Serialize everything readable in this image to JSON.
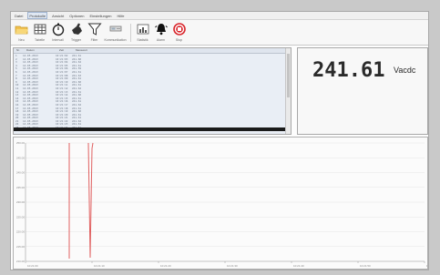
{
  "menu": {
    "items": [
      "Datei",
      "Protokolle",
      "Ansicht",
      "Optionen",
      "Einstellungen",
      "Hilfe"
    ],
    "active_index": 1
  },
  "toolbar": {
    "items": [
      {
        "label": "Neu",
        "icon": "folder-open-icon"
      },
      {
        "label": "Tabelle",
        "icon": "table-icon"
      },
      {
        "label": "Intervall",
        "icon": "stopwatch-icon"
      },
      {
        "label": "Trigger",
        "icon": "hand-pointer-icon"
      },
      {
        "label": "Filter",
        "icon": "funnel-icon"
      },
      {
        "label": "Kommunikation",
        "icon": "device-icon"
      },
      {
        "label": "Statistik",
        "icon": "chart-icon"
      },
      {
        "label": "Alarm",
        "icon": "bell-icon"
      },
      {
        "label": "Stop",
        "icon": "stop-icon"
      }
    ]
  },
  "log": {
    "headers": [
      "Nr.",
      "Datum",
      "Zeit",
      "Messwert"
    ],
    "rows": [
      [
        "1",
        "14.05.2013",
        "10:21:02",
        "241.61"
      ],
      [
        "2",
        "14.05.2013",
        "10:21:03",
        "241.60"
      ],
      [
        "3",
        "14.05.2013",
        "10:21:04",
        "241.62"
      ],
      [
        "4",
        "14.05.2013",
        "10:21:05",
        "241.61"
      ],
      [
        "5",
        "14.05.2013",
        "10:21:06",
        "241.59"
      ],
      [
        "6",
        "14.05.2013",
        "10:21:07",
        "241.61"
      ],
      [
        "7",
        "14.05.2013",
        "10:21:08",
        "241.63"
      ],
      [
        "8",
        "14.05.2013",
        "10:21:09",
        "241.61"
      ],
      [
        "9",
        "14.05.2013",
        "10:21:10",
        "241.60"
      ],
      [
        "10",
        "14.05.2013",
        "10:21:11",
        "241.61"
      ],
      [
        "11",
        "14.05.2013",
        "10:21:12",
        "241.62"
      ],
      [
        "12",
        "14.05.2013",
        "10:21:13",
        "241.61"
      ],
      [
        "13",
        "14.05.2013",
        "10:21:14",
        "241.60"
      ],
      [
        "14",
        "14.05.2013",
        "10:21:15",
        "241.61"
      ],
      [
        "15",
        "14.05.2013",
        "10:21:16",
        "241.61"
      ],
      [
        "16",
        "14.05.2013",
        "10:21:17",
        "241.62"
      ],
      [
        "17",
        "14.05.2013",
        "10:21:18",
        "241.61"
      ],
      [
        "18",
        "14.05.2013",
        "10:21:19",
        "241.60"
      ],
      [
        "19",
        "14.05.2013",
        "10:21:20",
        "241.61"
      ],
      [
        "20",
        "14.05.2013",
        "10:21:21",
        "241.61"
      ],
      [
        "21",
        "14.05.2013",
        "10:21:22",
        "241.62"
      ],
      [
        "22",
        "14.05.2013",
        "10:21:23",
        "241.61"
      ],
      [
        "23",
        "14.05.2013",
        "10:21:24",
        "241.61"
      ]
    ]
  },
  "readout": {
    "value": "241.61",
    "unit": "Vacdc"
  },
  "chart": {
    "title": "",
    "y_labels": [
      "250.00",
      "245.00",
      "240.00",
      "235.00",
      "230.00",
      "225.00",
      "220.00",
      "215.00",
      "210.00"
    ],
    "x_labels": [
      "10:21:00",
      "10:21:10",
      "10:21:20",
      "10:21:30",
      "10:21:40",
      "10:21:50",
      "10:22:00"
    ],
    "colors": {
      "trace": "#e06060",
      "grid": "#e4e4e4",
      "axis": "#9a9a9a",
      "labels": "#8a8a8a"
    }
  }
}
